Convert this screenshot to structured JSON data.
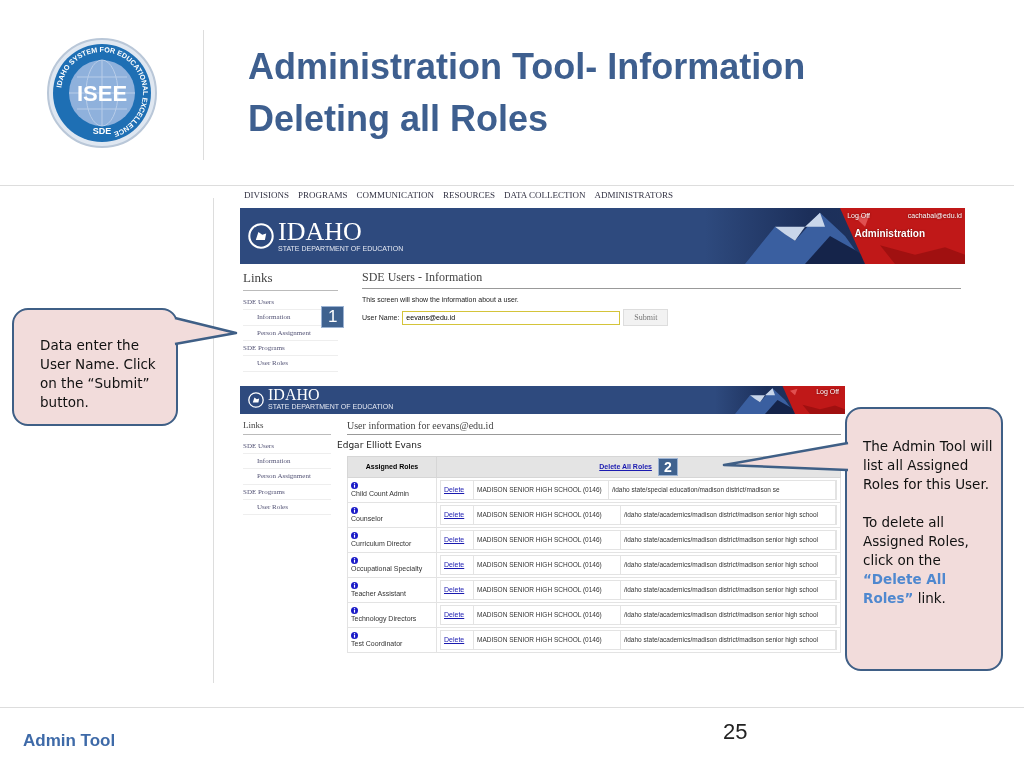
{
  "slide": {
    "title_lines": [
      "Administration Tool- Information",
      "Deleting all Roles"
    ],
    "footer": "Admin Tool",
    "page_number": "25"
  },
  "logo": {
    "ring_text": "IDAHO SYSTEM FOR EDUCATIONAL EXCELLENCE",
    "center": "ISEE",
    "bottom": "SDE"
  },
  "screen_1": {
    "nav": [
      "DIVISIONS",
      "PROGRAMS",
      "COMMUNICATION",
      "RESOURCES",
      "DATA COLLECTION",
      "ADMINISTRATORS"
    ],
    "brand": "IDAHO",
    "brand_sub": "STATE DEPARTMENT OF EDUCATION",
    "log_off": "Log Off",
    "user": "cachabal@edu.id",
    "area": "Administration",
    "links_title": "Links",
    "links": [
      {
        "label": "SDE Users",
        "children": [
          {
            "label": "Information"
          },
          {
            "label": "Person Assignment"
          }
        ]
      },
      {
        "label": "SDE Programs",
        "children": [
          {
            "label": "User Roles"
          }
        ]
      }
    ],
    "heading": "SDE Users - Information",
    "intro": "This screen will show the information about a user.",
    "field_label": "User Name:",
    "field_value": "eevans@edu.id",
    "submit": "Submit",
    "step": "1"
  },
  "screen_2": {
    "brand": "IDAHO",
    "brand_sub": "STATE DEPARTMENT OF EDUCATION",
    "log_off": "Log Off",
    "links_title": "Links",
    "links": [
      {
        "label": "SDE Users",
        "children": [
          {
            "label": "Information"
          },
          {
            "label": "Person Assignment"
          }
        ]
      },
      {
        "label": "SDE Programs",
        "children": [
          {
            "label": "User Roles"
          }
        ]
      }
    ],
    "heading": "User information for eevans@edu.id",
    "person": "Edgar Elliott Evans",
    "column_1": "Assigned Roles",
    "delete_all": "Delete All Roles",
    "step": "2",
    "rows": [
      {
        "role": "Child Count Admin",
        "action": "Delete",
        "school": "MADISON SENIOR HIGH SCHOOL (0146)",
        "path": "/idaho state/special education/madison district/madison se"
      },
      {
        "role": "Counselor",
        "action": "Delete",
        "school": "MADISON SENIOR HIGH SCHOOL (0146)",
        "path": "/idaho state/academics/madison district/madison senior high school"
      },
      {
        "role": "Curriculum Director",
        "action": "Delete",
        "school": "MADISON SENIOR HIGH SCHOOL (0146)",
        "path": "/idaho state/academics/madison district/madison senior high school"
      },
      {
        "role": "Occupational Specialty",
        "action": "Delete",
        "school": "MADISON SENIOR HIGH SCHOOL (0146)",
        "path": "/idaho state/academics/madison district/madison senior high school"
      },
      {
        "role": "Teacher Assistant",
        "action": "Delete",
        "school": "MADISON SENIOR HIGH SCHOOL (0146)",
        "path": "/idaho state/academics/madison district/madison senior high school"
      },
      {
        "role": "Technology Directors",
        "action": "Delete",
        "school": "MADISON SENIOR HIGH SCHOOL (0146)",
        "path": "/idaho state/academics/madison district/madison senior high school"
      },
      {
        "role": "Test Coordinator",
        "action": "Delete",
        "school": "MADISON SENIOR HIGH SCHOOL (0146)",
        "path": "/idaho state/academics/madison district/madison senior high school"
      }
    ]
  },
  "callouts": [
    {
      "paragraphs": [
        "Data enter the User Name.  Click on the “Submit” button."
      ]
    },
    {
      "paragraphs": [
        "The Admin Tool will list all Assigned Roles for this User.",
        "To delete all Assigned Roles, click on the **“Delete All Roles”** link."
      ]
    }
  ]
}
